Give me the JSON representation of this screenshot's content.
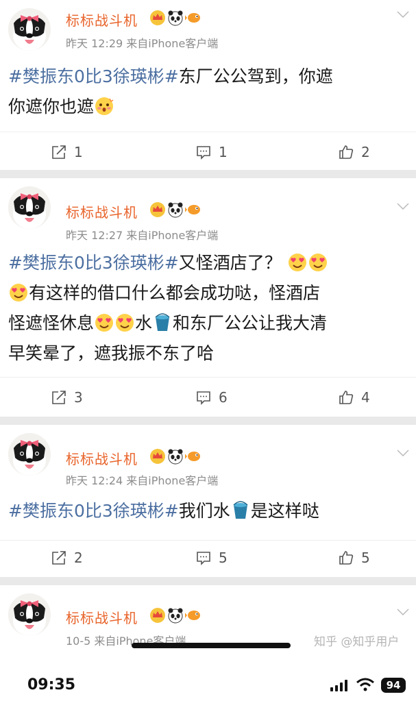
{
  "posts": [
    {
      "user": "标标战斗机",
      "meta": "昨天 12:29  来自iPhone客户端",
      "tag": "#樊振东0比3徐瑛彬#",
      "text_lines": [
        "东厂公公驾到，你遮",
        "你遮你也遮"
      ],
      "repost": "1",
      "comment": "1",
      "like": "2"
    },
    {
      "user": "标标战斗机",
      "meta": "昨天 12:27  来自iPhone客户端",
      "tag": "#樊振东0比3徐瑛彬#",
      "text_a": "又怪酒店了？",
      "text_b": "有这样的借口什么都会成功哒，怪酒店",
      "text_c": "怪遮怪休息",
      "text_c2": "水",
      "text_c3": "和东厂公公让我大清",
      "text_d": "早笑晕了，遮我振不东了哈",
      "repost": "3",
      "comment": "6",
      "like": "4"
    },
    {
      "user": "标标战斗机",
      "meta": "昨天 12:24  来自iPhone客户端",
      "tag": "#樊振东0比3徐瑛彬#",
      "text_a": "我们水",
      "text_b": "是这样哒",
      "repost": "2",
      "comment": "5",
      "like": "5"
    },
    {
      "user": "标标战斗机",
      "meta": "10-5  来自iPhone客户端"
    }
  ],
  "watermark": "知乎 @知乎用户",
  "status": {
    "time": "09:35",
    "battery": "94"
  },
  "colors": {
    "username": "#e8632a",
    "hashtag": "#4c6fa1",
    "meta": "#8c8c8c"
  },
  "icons": [
    "pink-bow-dog-avatar",
    "crown-badge-icon",
    "panda-badge-icon",
    "fish-badge-icon",
    "repost-icon",
    "comment-icon",
    "like-icon",
    "chevron-down-icon",
    "heart-eyes-emoji",
    "blush-emoji",
    "bucket-emoji"
  ]
}
